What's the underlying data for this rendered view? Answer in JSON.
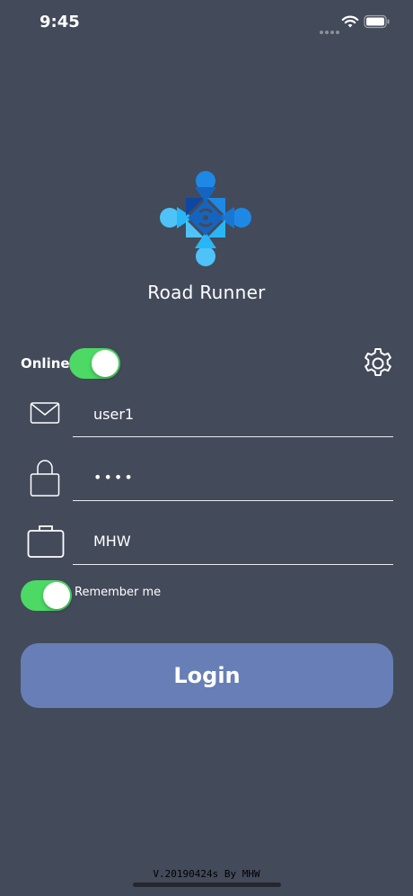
{
  "status_bar": {
    "time": "9:45",
    "icons": [
      "signal-dots-icon",
      "wifi-icon",
      "battery-icon"
    ]
  },
  "app": {
    "title": "Road Runner",
    "logo": "road-runner-arrows-logo",
    "colors": {
      "background": "#434a5a",
      "toggle_on": "#4cd964",
      "login_button": "#677fb6",
      "logo_light": "#29b6f6",
      "logo_dark": "#1565c0"
    }
  },
  "mode": {
    "label": "Online",
    "on": true
  },
  "settings": {
    "icon": "gear-icon"
  },
  "form": {
    "username": {
      "icon": "envelope-icon",
      "value": "user1"
    },
    "password": {
      "icon": "lock-icon",
      "value": "••••"
    },
    "company": {
      "icon": "briefcase-icon",
      "value": "MHW"
    }
  },
  "remember": {
    "label": "Remember me",
    "on": true
  },
  "login_button": {
    "label": "Login"
  },
  "footer": {
    "version": "V.20190424s By MHW"
  }
}
